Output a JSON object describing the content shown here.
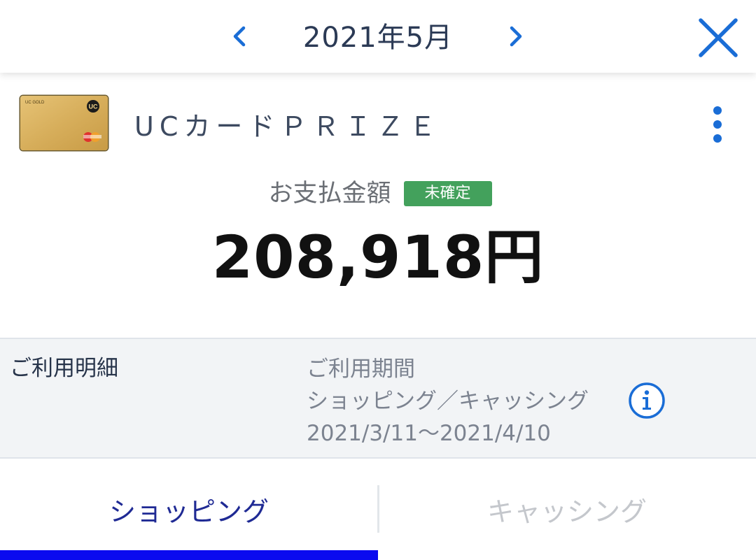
{
  "header": {
    "month_title": "2021年5月"
  },
  "card": {
    "name": "UCカードＰＲＩＺＥ",
    "image_text_brand": "UC GOLD",
    "image_text_logo": "UC"
  },
  "payment": {
    "label": "お支払金額",
    "status_badge": "未確定",
    "amount": "208,918円"
  },
  "details": {
    "title": "ご利用明細",
    "period_label": "ご利用期間",
    "period_type": "ショッピング／キャッシング",
    "period_range": "2021/3/11～2021/4/10"
  },
  "tabs": [
    {
      "label": "ショッピング",
      "selected": true
    },
    {
      "label": "キャッシング",
      "selected": false
    }
  ],
  "colors": {
    "accent_blue": "#1a6dd6",
    "badge_green": "#43a15c",
    "tab_active_text": "#1f2a94",
    "tab_indicator": "#0a0aef",
    "card_gold": "#d9b25e"
  },
  "icons": {
    "prev": "chevron-left-icon",
    "next": "chevron-right-icon",
    "close": "close-icon",
    "more": "more-vertical-icon",
    "info": "info-icon"
  }
}
